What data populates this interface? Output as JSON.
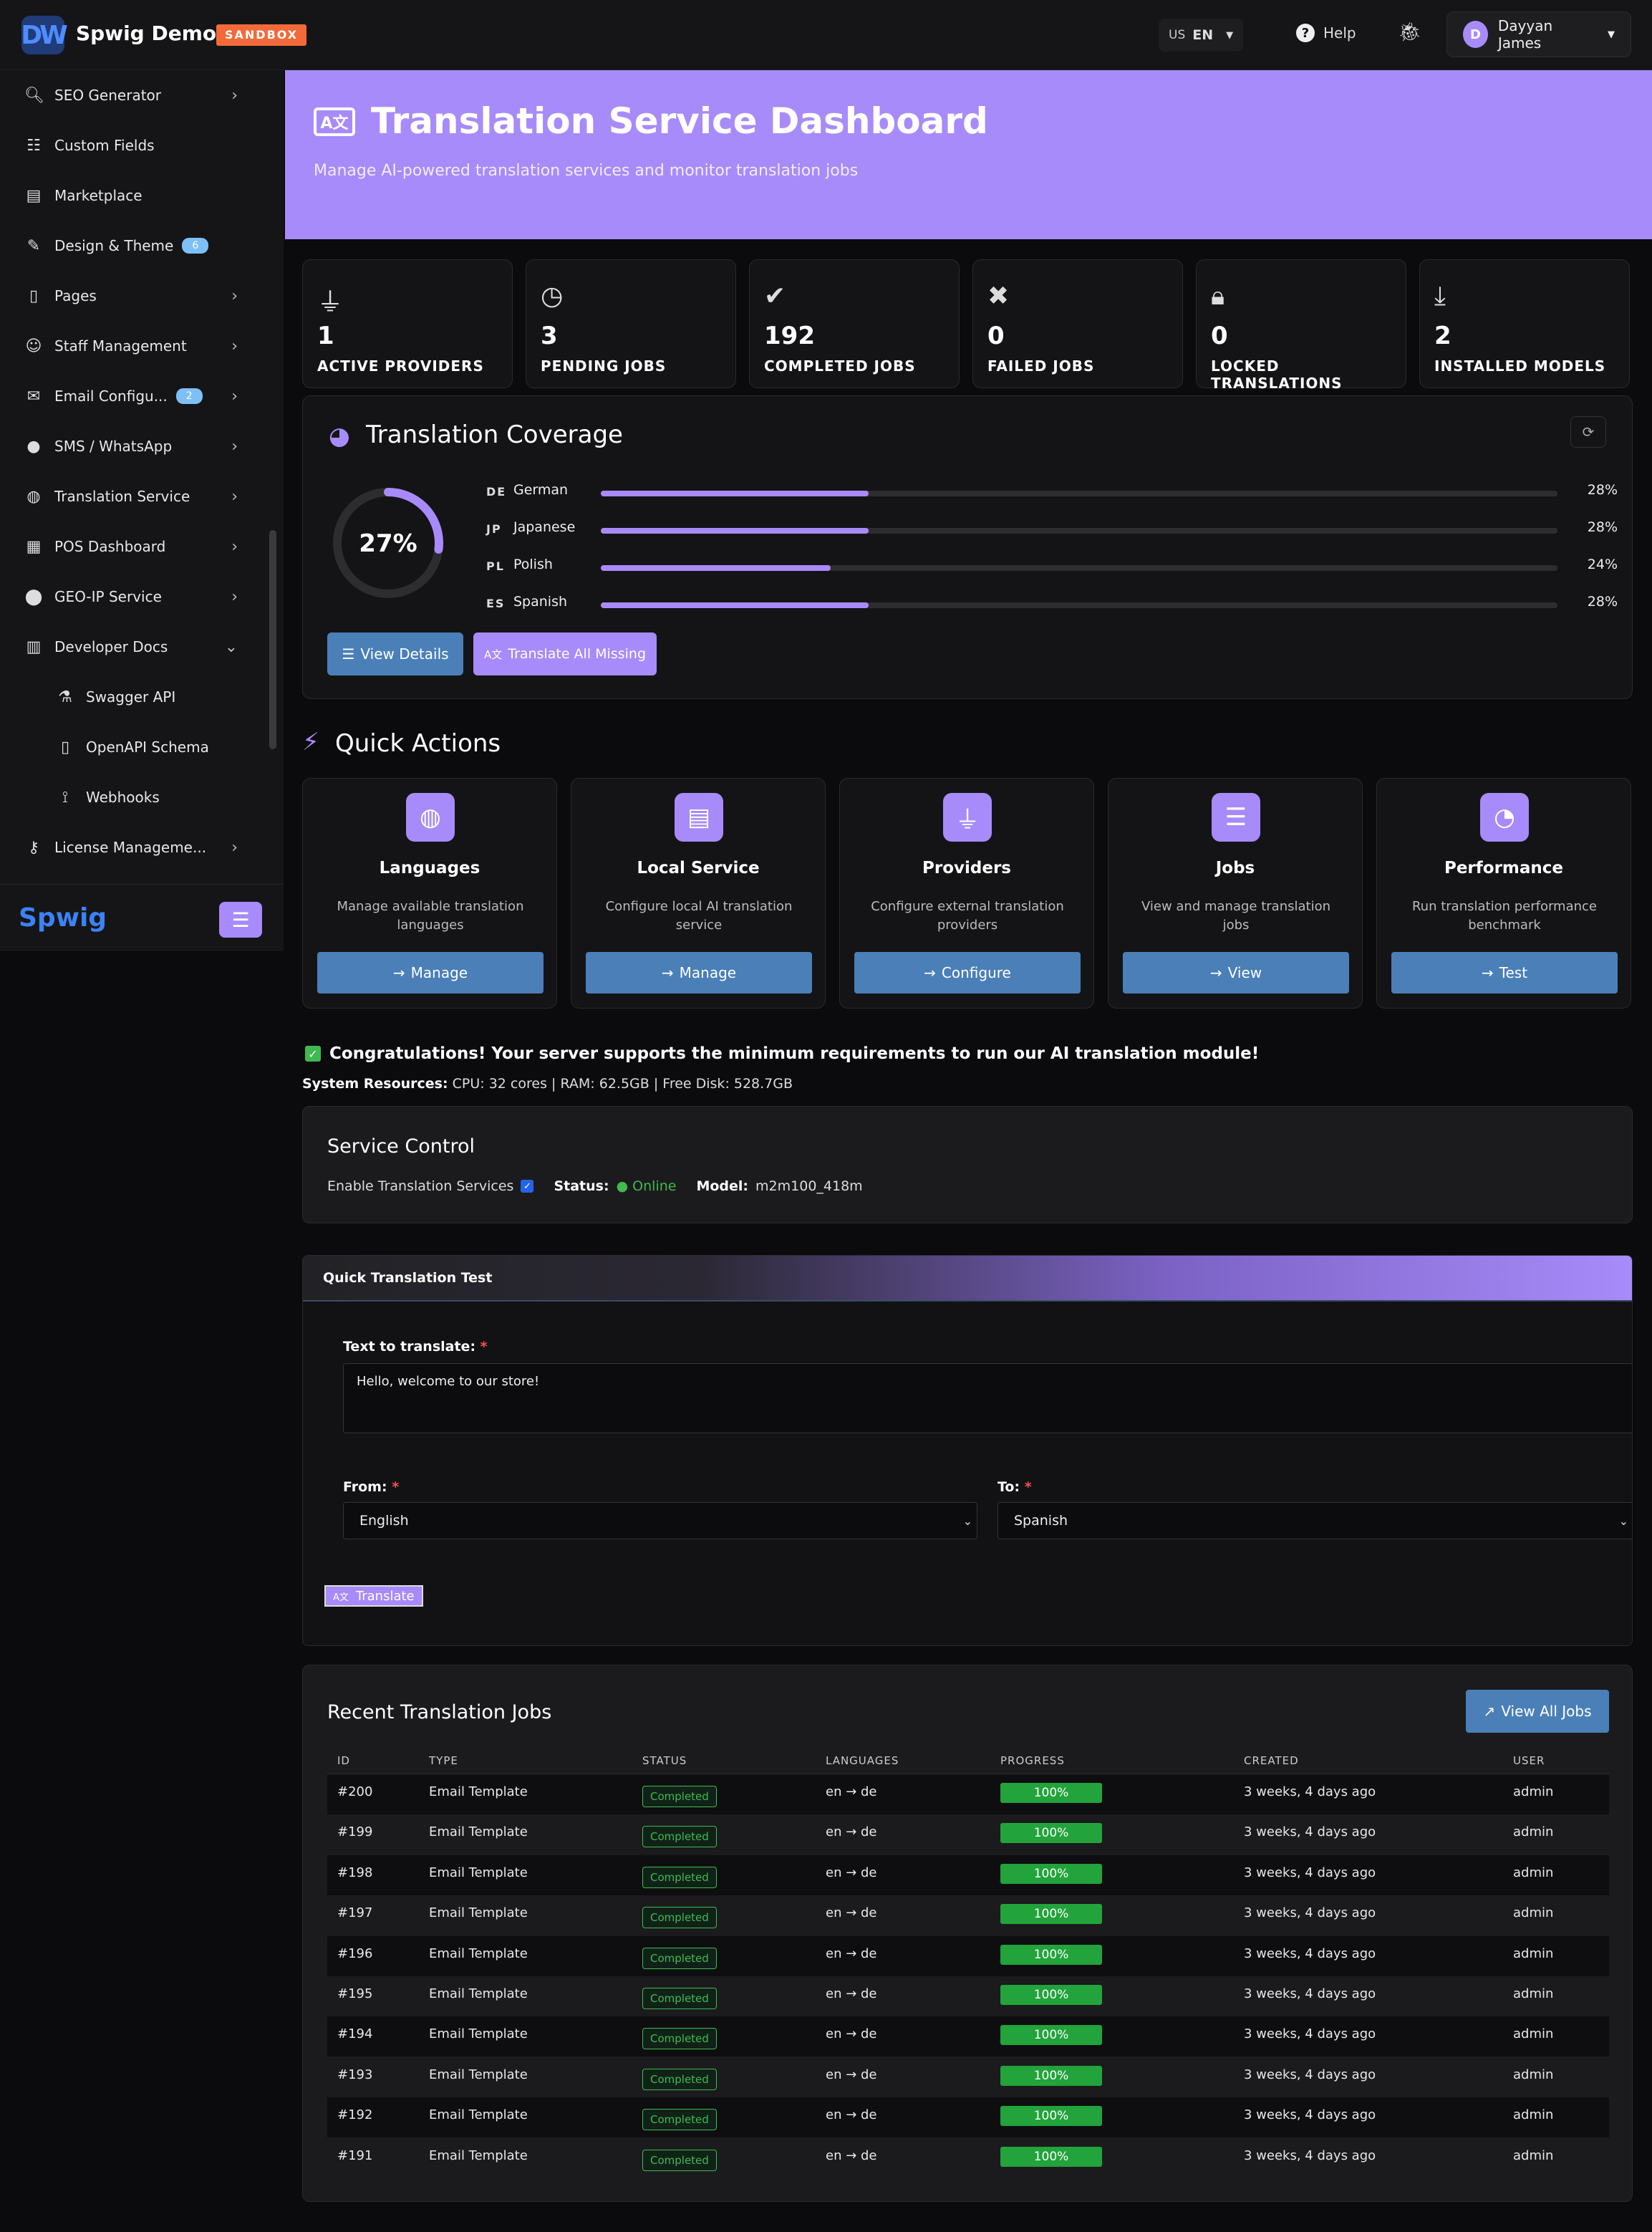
{
  "header": {
    "logo_text": "DW",
    "app_title": "Spwig Demo",
    "env_badge": "SANDBOX",
    "language": {
      "country": "US",
      "code": "EN",
      "caret": "▼"
    },
    "help_label": "Help",
    "user": {
      "initial": "D",
      "name": "Dayyan James",
      "caret": "▼"
    }
  },
  "sidebar": {
    "items": [
      {
        "label": "SEO Generator",
        "icon": "search-icon",
        "chevron": "›"
      },
      {
        "label": "Custom Fields",
        "icon": "sliders-icon",
        "chevron": ""
      },
      {
        "label": "Marketplace",
        "icon": "store-icon",
        "chevron": ""
      },
      {
        "label": "Design & Theme",
        "icon": "brush-icon",
        "badge": "6",
        "chevron": ""
      },
      {
        "label": "Pages",
        "icon": "file-icon",
        "chevron": "›"
      },
      {
        "label": "Staff Management",
        "icon": "user-cog-icon",
        "chevron": "›"
      },
      {
        "label": "Email Configu...",
        "icon": "mail-icon",
        "badge": "2",
        "chevron": "›"
      },
      {
        "label": "SMS / WhatsApp",
        "icon": "chat-icon",
        "chevron": "›"
      },
      {
        "label": "Translation Service",
        "icon": "globe-icon",
        "chevron": "›"
      },
      {
        "label": "POS Dashboard",
        "icon": "cash-register-icon",
        "chevron": "›"
      },
      {
        "label": "GEO-IP Service",
        "icon": "map-pin-icon",
        "chevron": "›"
      },
      {
        "label": "Developer Docs",
        "icon": "book-icon",
        "chevron": "⌄"
      },
      {
        "label": "Swagger API",
        "icon": "flask-icon",
        "sub": true,
        "chevron": ""
      },
      {
        "label": "OpenAPI Schema",
        "icon": "file-code-icon",
        "sub": true,
        "chevron": ""
      },
      {
        "label": "Webhooks",
        "icon": "broadcast-icon",
        "sub": true,
        "chevron": ""
      },
      {
        "label": "License Manageme...",
        "icon": "key-icon",
        "chevron": "›"
      }
    ],
    "footer_logo": "Spwig"
  },
  "banner": {
    "title": "Translation Service Dashboard",
    "subtitle": "Manage AI-powered translation services and monitor translation jobs",
    "icon_text": "A文"
  },
  "stats": [
    {
      "value": "1",
      "label": "ACTIVE PROVIDERS",
      "icon": "plug-icon"
    },
    {
      "value": "3",
      "label": "PENDING JOBS",
      "icon": "clock-icon"
    },
    {
      "value": "192",
      "label": "COMPLETED JOBS",
      "icon": "check-circle-icon"
    },
    {
      "value": "0",
      "label": "FAILED JOBS",
      "icon": "x-circle-icon"
    },
    {
      "value": "0",
      "label": "LOCKED TRANSLATIONS",
      "icon": "lock-icon"
    },
    {
      "value": "2",
      "label": "INSTALLED MODELS",
      "icon": "download-icon"
    }
  ],
  "coverage": {
    "title": "Translation Coverage",
    "overall_pct": 27,
    "overall_label": "27%",
    "languages": [
      {
        "code": "DE",
        "name": "German",
        "pct": 28,
        "label": "28%"
      },
      {
        "code": "JP",
        "name": "Japanese",
        "pct": 28,
        "label": "28%"
      },
      {
        "code": "PL",
        "name": "Polish",
        "pct": 24,
        "label": "24%"
      },
      {
        "code": "ES",
        "name": "Spanish",
        "pct": 28,
        "label": "28%"
      }
    ],
    "view_details_label": "View Details",
    "translate_missing_label": "Translate All Missing"
  },
  "quick_actions": {
    "title": "Quick Actions",
    "cards": [
      {
        "title": "Languages",
        "desc": "Manage available translation languages",
        "button": "Manage",
        "icon": "globe-icon"
      },
      {
        "title": "Local Service",
        "desc": "Configure local AI translation service",
        "button": "Manage",
        "icon": "server-icon"
      },
      {
        "title": "Providers",
        "desc": "Configure external translation providers",
        "button": "Configure",
        "icon": "plug-icon"
      },
      {
        "title": "Jobs",
        "desc": "View and manage translation jobs",
        "button": "View",
        "icon": "list-icon"
      },
      {
        "title": "Performance",
        "desc": "Run translation performance benchmark",
        "button": "Test",
        "icon": "gauge-icon"
      }
    ]
  },
  "requirements": {
    "message": "Congratulations! Your server supports the minimum requirements to run our AI translation module!",
    "resources_label": "System Resources:",
    "resources_value": "CPU: 32 cores | RAM: 62.5GB | Free Disk: 528.7GB"
  },
  "service_control": {
    "title": "Service Control",
    "enable_label": "Enable Translation Services",
    "status_label": "Status:",
    "status_value": "● Online",
    "model_label": "Model:",
    "model_value": "m2m100_418m"
  },
  "quick_test": {
    "title": "Quick Translation Test",
    "text_label": "Text to translate:",
    "text_value": "Hello, welcome to our store!",
    "from_label": "From:",
    "from_value": "English",
    "to_label": "To:",
    "to_value": "Spanish",
    "required_mark": "*",
    "translate_label": "Translate"
  },
  "jobs": {
    "title": "Recent Translation Jobs",
    "view_all_label": "View All Jobs",
    "columns": [
      "ID",
      "TYPE",
      "STATUS",
      "LANGUAGES",
      "PROGRESS",
      "CREATED",
      "USER"
    ],
    "rows": [
      {
        "id": "#200",
        "type": "Email Template",
        "status": "Completed",
        "languages": "en → de",
        "progress": "100%",
        "created": "3 weeks, 4 days ago",
        "user": "admin"
      },
      {
        "id": "#199",
        "type": "Email Template",
        "status": "Completed",
        "languages": "en → de",
        "progress": "100%",
        "created": "3 weeks, 4 days ago",
        "user": "admin"
      },
      {
        "id": "#198",
        "type": "Email Template",
        "status": "Completed",
        "languages": "en → de",
        "progress": "100%",
        "created": "3 weeks, 4 days ago",
        "user": "admin"
      },
      {
        "id": "#197",
        "type": "Email Template",
        "status": "Completed",
        "languages": "en → de",
        "progress": "100%",
        "created": "3 weeks, 4 days ago",
        "user": "admin"
      },
      {
        "id": "#196",
        "type": "Email Template",
        "status": "Completed",
        "languages": "en → de",
        "progress": "100%",
        "created": "3 weeks, 4 days ago",
        "user": "admin"
      },
      {
        "id": "#195",
        "type": "Email Template",
        "status": "Completed",
        "languages": "en → de",
        "progress": "100%",
        "created": "3 weeks, 4 days ago",
        "user": "admin"
      },
      {
        "id": "#194",
        "type": "Email Template",
        "status": "Completed",
        "languages": "en → de",
        "progress": "100%",
        "created": "3 weeks, 4 days ago",
        "user": "admin"
      },
      {
        "id": "#193",
        "type": "Email Template",
        "status": "Completed",
        "languages": "en → de",
        "progress": "100%",
        "created": "3 weeks, 4 days ago",
        "user": "admin"
      },
      {
        "id": "#192",
        "type": "Email Template",
        "status": "Completed",
        "languages": "en → de",
        "progress": "100%",
        "created": "3 weeks, 4 days ago",
        "user": "admin"
      },
      {
        "id": "#191",
        "type": "Email Template",
        "status": "Completed",
        "languages": "en → de",
        "progress": "100%",
        "created": "3 weeks, 4 days ago",
        "user": "admin"
      }
    ]
  },
  "colors": {
    "accent": "#a78bfa",
    "button_blue": "#4a7fb8",
    "success": "#3fb950",
    "background": "#0b0b0d"
  }
}
